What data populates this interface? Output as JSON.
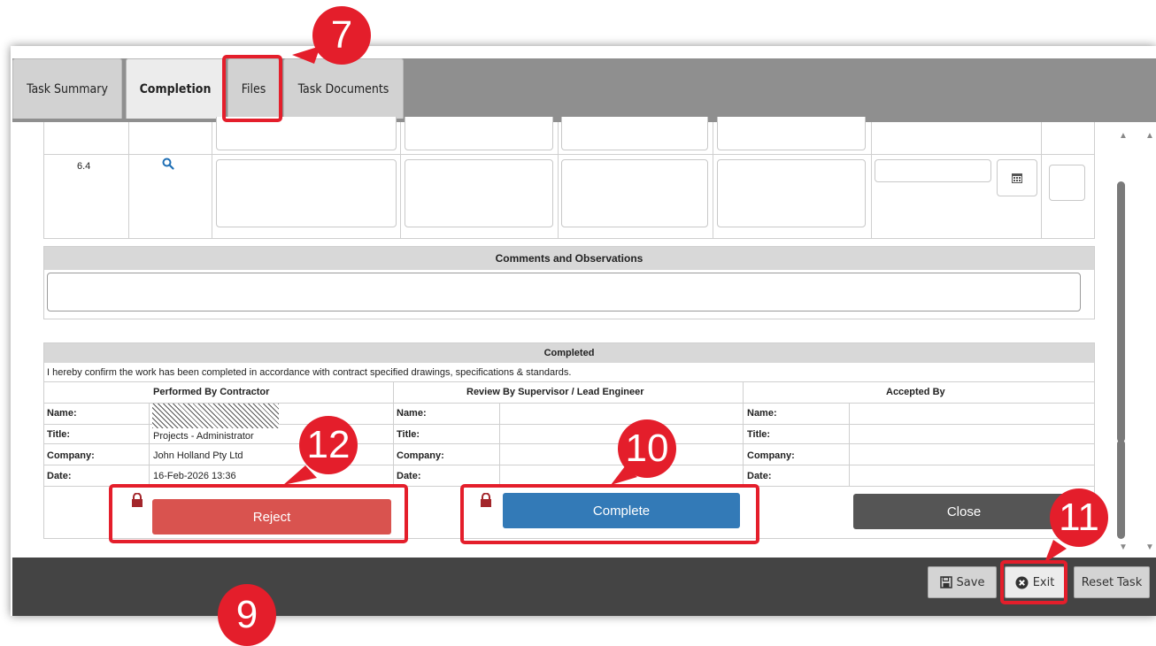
{
  "tabs": [
    {
      "label": "Task Summary",
      "active": false
    },
    {
      "label": "Completion",
      "active": true
    },
    {
      "label": "Files",
      "active": false
    },
    {
      "label": "Task Documents",
      "active": false
    }
  ],
  "grid": {
    "row_number": "6.4"
  },
  "comments": {
    "header": "Comments and Observations",
    "value": ""
  },
  "completed": {
    "header": "Completed",
    "confirmation": "I hereby confirm the work has been completed in accordance with contract specified drawings, specifications & standards.",
    "columns": [
      {
        "title": "Performed By Contractor"
      },
      {
        "title": "Review By Supervisor / Lead Engineer"
      },
      {
        "title": "Accepted By"
      }
    ],
    "field_labels": {
      "name": "Name:",
      "title": "Title:",
      "company": "Company:",
      "date": "Date:"
    },
    "contractor": {
      "title": "Projects - Administrator",
      "company": "John Holland Pty Ltd",
      "date": "16-Feb-2026 13:36"
    }
  },
  "actions": {
    "reject_label": "Reject",
    "complete_label": "Complete",
    "close_label": "Close"
  },
  "footer": {
    "save_label": "Save",
    "exit_label": "Exit",
    "reset_label": "Reset Task"
  },
  "callouts": [
    "7",
    "9",
    "10",
    "11",
    "12"
  ],
  "colors": {
    "reject": "#d9534f",
    "complete": "#337ab7",
    "close": "#555555",
    "callout": "#e41e2b"
  }
}
